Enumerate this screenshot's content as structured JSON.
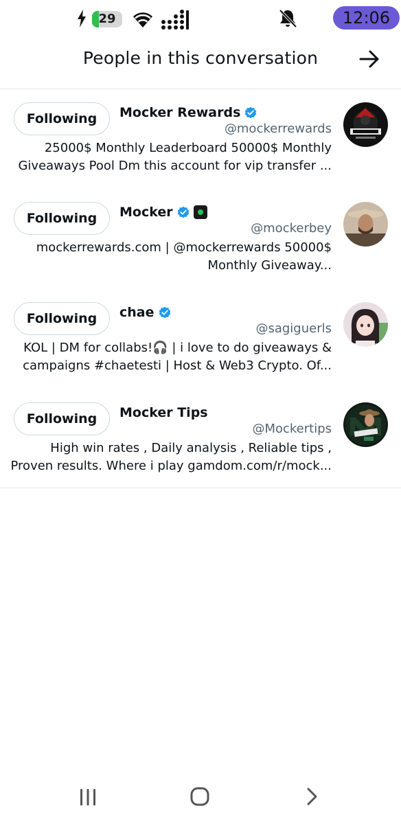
{
  "status_bar": {
    "battery_level": "29",
    "time": "12:06",
    "icons": [
      "charging-bolt-icon",
      "battery-icon",
      "wifi-icon",
      "signal-icon",
      "mute-icon"
    ],
    "clock_color": "#6a5ad6"
  },
  "header": {
    "title": "People in this conversation",
    "forward_icon": "arrow-right-icon"
  },
  "people": [
    {
      "follow_label": "Following",
      "name": "Mocker Rewards",
      "verified": true,
      "handle": "@mockerrewards",
      "bio": "25000$ Monthly Leaderboard 50000$ Monthly Giveaways Pool Dm this account for vip transfer ..."
    },
    {
      "follow_label": "Following",
      "name": "Mocker",
      "verified": true,
      "handle": "@mockerbey",
      "bio": "mockerrewards.com | @mockerrewards 50000$ Monthly Giveaway..."
    },
    {
      "follow_label": "Following",
      "name": "chae",
      "verified": true,
      "handle": "@sagiguerls",
      "bio": "KOL | DM for collabs!🎧 | i love to do giveaways & campaigns #chaetesti | Host & Web3 Crypto. Of..."
    },
    {
      "follow_label": "Following",
      "name": "Mocker Tips",
      "verified": false,
      "handle": "@Mockertips",
      "bio": "High win rates , Daily analysis , Reliable tips , Proven results. Where i play gamdom.com/r/mock..."
    }
  ],
  "nav_bar": {
    "icons": [
      "recents-icon",
      "home-icon",
      "back-icon"
    ]
  },
  "colors": {
    "verified_blue": "#1d9bf0",
    "divider": "#e6e8ee",
    "secondary_text": "#536471"
  }
}
